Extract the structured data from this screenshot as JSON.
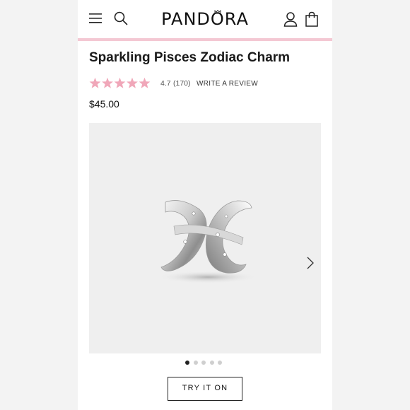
{
  "header": {
    "logo": "PANDORA",
    "icons": [
      "menu-icon",
      "search-icon",
      "account-icon",
      "bag-icon"
    ]
  },
  "product": {
    "title": "Sparkling Pisces Zodiac Charm",
    "rating": {
      "stars": 5,
      "value": "4.7",
      "count": "(170)",
      "write_review": "WRITE A REVIEW"
    },
    "price": "$45.00"
  },
  "gallery": {
    "slide_count": 5,
    "active_slide": 1,
    "next_icon": "chevron-right-icon"
  },
  "actions": {
    "try_it_on": "TRY IT ON"
  },
  "colors": {
    "accent_pink": "#f4c8d3",
    "star_pink": "#f0a7b9",
    "image_bg": "#efefef"
  }
}
